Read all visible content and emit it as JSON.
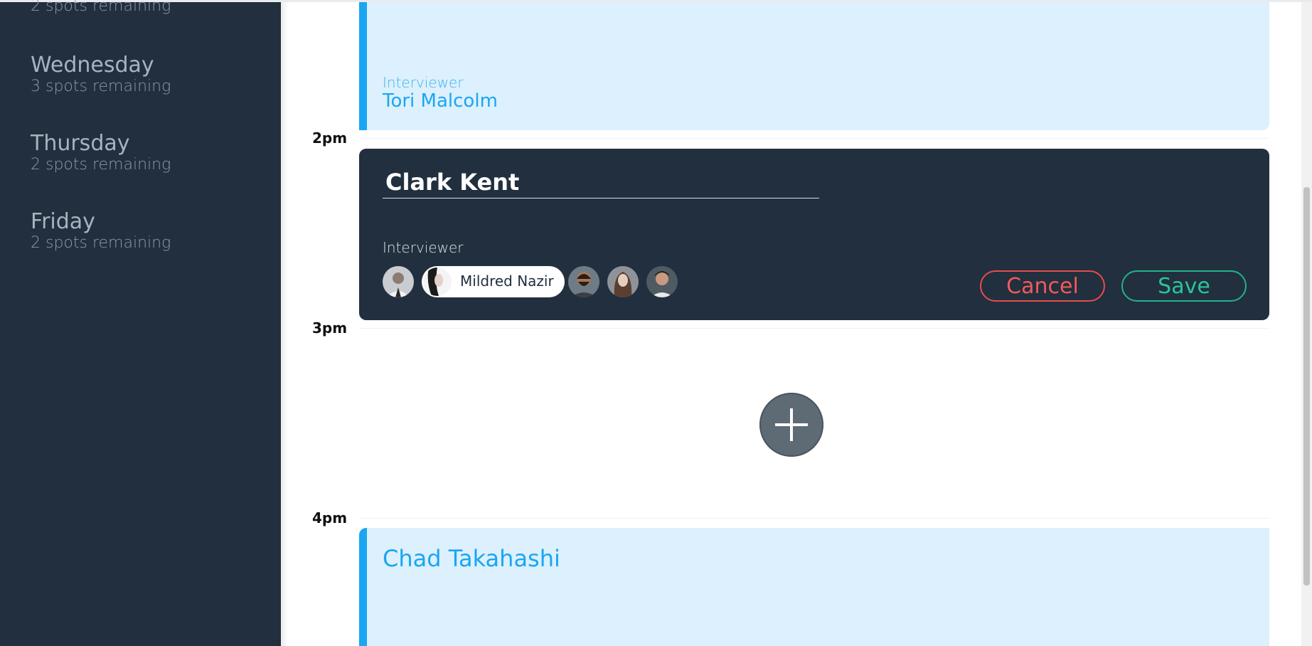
{
  "sidebar": {
    "days": [
      {
        "name": "",
        "spots": "2 spots remaining"
      },
      {
        "name": "Wednesday",
        "spots": "3 spots remaining"
      },
      {
        "name": "Thursday",
        "spots": "2 spots remaining"
      },
      {
        "name": "Friday",
        "spots": "2 spots remaining"
      }
    ]
  },
  "schedule": {
    "times": [
      "2pm",
      "3pm",
      "4pm"
    ],
    "appointment_top": {
      "interviewer_label": "Interviewer",
      "interviewer_name": "Tori Malcolm"
    },
    "edit_form": {
      "student_name": "Clark Kent",
      "interviewer_label": "Interviewer",
      "selected_interviewer": "Mildred Nazir",
      "cancel_label": "Cancel",
      "save_label": "Save"
    },
    "appointment_bottom": {
      "student_name": "Chad Takahashi"
    }
  },
  "colors": {
    "sidebar_bg": "#222f3e",
    "appointment_bg": "#dcf0fd",
    "appointment_accent": "#1aa6f2",
    "cancel": "#e44d4d",
    "save": "#1fb48c"
  }
}
